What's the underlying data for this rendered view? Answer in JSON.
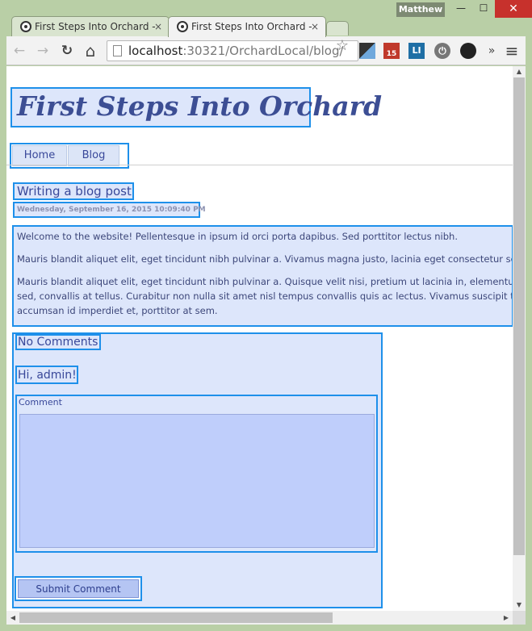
{
  "window": {
    "user": "Matthew",
    "minimize": "—",
    "maximize": "☐",
    "close": "✕"
  },
  "tabs": [
    {
      "label": "First Steps Into Orchard -",
      "close": "×"
    },
    {
      "label": "First Steps Into Orchard -",
      "close": "×"
    }
  ],
  "toolbar": {
    "back": "←",
    "forward": "→",
    "reload": "↻",
    "home": "⌂",
    "url_host": "localhost",
    "url_rest": ":30321/OrchardLocal/blog/",
    "star": "☆",
    "ext_badge": "15",
    "ext_li": "LI",
    "ext_power": "⏻",
    "overflow": "»",
    "menu": "≡"
  },
  "page": {
    "site_title": "First Steps Into Orchard",
    "menu": [
      "Home",
      "Blog"
    ],
    "post_title": "Writing a blog post",
    "post_date": "Wednesday, September 16, 2015 10:09:40 PM",
    "paragraphs": [
      "Welcome to the website! Pellentesque in ipsum id orci porta dapibus. Sed porttitor lectus nibh.",
      "Mauris blandit aliquet elit, eget tincidunt nibh pulvinar a. Vivamus magna justo, lacinia eget consectetur sed",
      "Mauris blandit aliquet elit, eget tincidunt nibh pulvinar a. Quisque velit nisi, pretium ut lacinia in, elementum",
      "sed, convallis at tellus. Curabitur non nulla sit amet nisl tempus convallis quis ac lectus. Vivamus suscipit tor",
      "accumsan id imperdiet et, porttitor at sem."
    ],
    "comments_heading": "No Comments",
    "greeting": "Hi, admin!",
    "comment_label": "Comment",
    "comment_value": "",
    "submit_label": "Submit Comment"
  },
  "colors": {
    "highlight_border": "#1e90ea",
    "highlight_fill": "#dde6fb",
    "title_text": "#3c4e94"
  }
}
